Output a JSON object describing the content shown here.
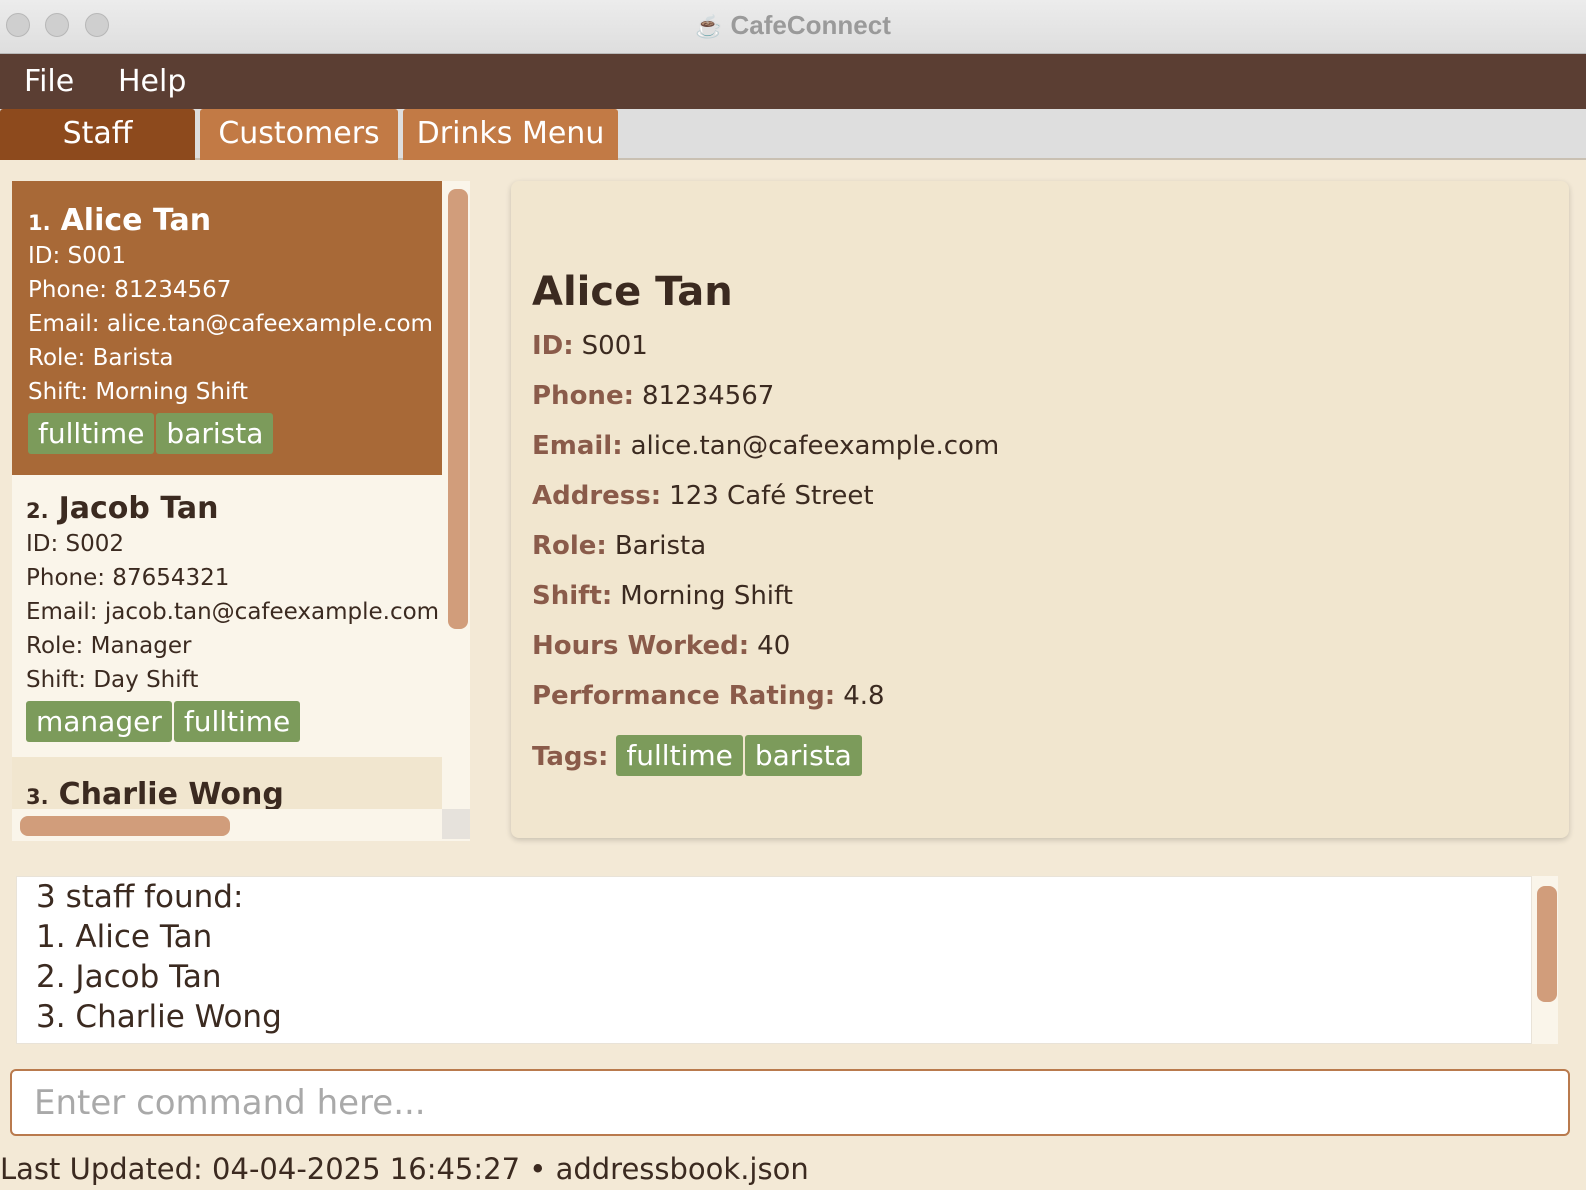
{
  "window": {
    "title": "CafeConnect",
    "icon": "coffee-cup-icon"
  },
  "menu": {
    "items": [
      "File",
      "Help"
    ]
  },
  "tabs": [
    {
      "label": "Staff",
      "active": true
    },
    {
      "label": "Customers",
      "active": false
    },
    {
      "label": "Drinks Menu",
      "active": false
    }
  ],
  "staff_list": [
    {
      "index": "1.",
      "name": "Alice Tan",
      "id": "ID: S001",
      "phone": "Phone: 81234567",
      "email": "Email: alice.tan@cafeexample.com",
      "role": "Role: Barista",
      "shift": "Shift: Morning Shift",
      "tags": [
        "fulltime",
        "barista"
      ],
      "selected": true
    },
    {
      "index": "2.",
      "name": "Jacob Tan",
      "id": "ID: S002",
      "phone": "Phone: 87654321",
      "email": "Email: jacob.tan@cafeexample.com",
      "role": "Role: Manager",
      "shift": "Shift: Day Shift",
      "tags": [
        "manager",
        "fulltime"
      ],
      "selected": false
    },
    {
      "index": "3.",
      "name": "Charlie Wong",
      "selected": false
    }
  ],
  "detail": {
    "name": "Alice Tan",
    "fields": [
      {
        "label": "ID:",
        "value": "S001"
      },
      {
        "label": "Phone:",
        "value": "81234567"
      },
      {
        "label": "Email:",
        "value": "alice.tan@cafeexample.com"
      },
      {
        "label": "Address:",
        "value": "123 Café Street"
      },
      {
        "label": "Role:",
        "value": "Barista"
      },
      {
        "label": "Shift:",
        "value": "Morning Shift"
      },
      {
        "label": "Hours Worked:",
        "value": "40"
      },
      {
        "label": "Performance Rating:",
        "value": "4.8"
      }
    ],
    "tags_label": "Tags:",
    "tags": [
      "fulltime",
      "barista"
    ]
  },
  "result": {
    "lines": [
      "3 staff found:",
      "1. Alice Tan",
      "2. Jacob Tan",
      "3. Charlie Wong"
    ]
  },
  "command": {
    "placeholder": "Enter command here...",
    "value": ""
  },
  "status": {
    "text": "Last Updated: 04-04-2025 16:45:27 • addressbook.json"
  },
  "colors": {
    "menubar": "#5b3e33",
    "tab_active": "#8d4a1d",
    "tab_inactive": "#c27a45",
    "card_selected": "#a86937",
    "tag": "#7c9b5b",
    "scrollbar": "#d19d7b"
  }
}
